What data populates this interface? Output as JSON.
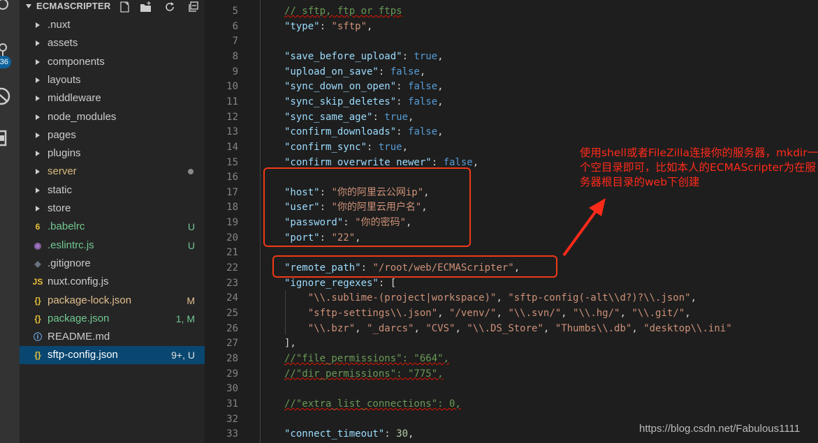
{
  "sidebar": {
    "folder": "ECMASCRIPTER",
    "items": [
      {
        "kind": "folder",
        "label": ".nuxt",
        "status": "",
        "color": "#cccccc"
      },
      {
        "kind": "folder",
        "label": "assets",
        "status": "",
        "color": "#cccccc"
      },
      {
        "kind": "folder",
        "label": "components",
        "status": "",
        "color": "#cccccc"
      },
      {
        "kind": "folder",
        "label": "layouts",
        "status": "",
        "color": "#cccccc"
      },
      {
        "kind": "folder",
        "label": "middleware",
        "status": "",
        "color": "#cccccc"
      },
      {
        "kind": "folder",
        "label": "node_modules",
        "status": "",
        "color": "#cccccc"
      },
      {
        "kind": "folder",
        "label": "pages",
        "status": "",
        "color": "#cccccc"
      },
      {
        "kind": "folder",
        "label": "plugins",
        "status": "",
        "color": "#cccccc"
      },
      {
        "kind": "folder",
        "label": "server",
        "status": "dot",
        "color": "#d7ba7d"
      },
      {
        "kind": "folder",
        "label": "static",
        "status": "",
        "color": "#cccccc"
      },
      {
        "kind": "folder",
        "label": "store",
        "status": "",
        "color": "#cccccc"
      },
      {
        "kind": "babel",
        "label": ".babelrc",
        "status": "U",
        "color": "#73c991",
        "icon": "6",
        "icon_color": "#e8c237"
      },
      {
        "kind": "eslint",
        "label": ".eslintrc.js",
        "status": "U",
        "color": "#73c991",
        "icon": "◉",
        "icon_color": "#a074c4"
      },
      {
        "kind": "git",
        "label": ".gitignore",
        "status": "",
        "color": "#cccccc",
        "icon": "◆",
        "icon_color": "#6a737d"
      },
      {
        "kind": "js",
        "label": "nuxt.config.js",
        "status": "",
        "color": "#cccccc",
        "icon": "JS",
        "icon_color": "#e8c237"
      },
      {
        "kind": "json",
        "label": "package-lock.json",
        "status": "M",
        "color": "#e2c08d",
        "icon": "{}",
        "icon_color": "#e8c237"
      },
      {
        "kind": "json",
        "label": "package.json",
        "status": "1, M",
        "color": "#73c991",
        "icon": "{}",
        "icon_color": "#e8c237"
      },
      {
        "kind": "info",
        "label": "README.md",
        "status": "",
        "color": "#cccccc",
        "icon": "ⓘ",
        "icon_color": "#75beff"
      },
      {
        "kind": "json",
        "label": "sftp-config.json",
        "status": "9+, U",
        "color": "#ffffff",
        "icon": "{}",
        "icon_color": "#e8c237",
        "selected": true
      }
    ]
  },
  "activity": {
    "badge": "36"
  },
  "editor": {
    "lines": [
      {
        "n": "5",
        "t": [
          [
            "c",
            "// sftp, ftp or ftps"
          ]
        ]
      },
      {
        "n": "6",
        "t": [
          [
            "k",
            "\"type\""
          ],
          [
            "p",
            ": "
          ],
          [
            "s",
            "\"sftp\""
          ],
          [
            "p",
            ","
          ]
        ]
      },
      {
        "n": "7",
        "t": []
      },
      {
        "n": "8",
        "t": [
          [
            "k",
            "\"save_before_upload\""
          ],
          [
            "p",
            ": "
          ],
          [
            "b",
            "true"
          ],
          [
            "p",
            ","
          ]
        ]
      },
      {
        "n": "9",
        "t": [
          [
            "k",
            "\"upload_on_save\""
          ],
          [
            "p",
            ": "
          ],
          [
            "b",
            "false"
          ],
          [
            "p",
            ","
          ]
        ]
      },
      {
        "n": "10",
        "t": [
          [
            "k",
            "\"sync_down_on_open\""
          ],
          [
            "p",
            ": "
          ],
          [
            "b",
            "false"
          ],
          [
            "p",
            ","
          ]
        ]
      },
      {
        "n": "11",
        "t": [
          [
            "k",
            "\"sync_skip_deletes\""
          ],
          [
            "p",
            ": "
          ],
          [
            "b",
            "false"
          ],
          [
            "p",
            ","
          ]
        ]
      },
      {
        "n": "12",
        "t": [
          [
            "k",
            "\"sync_same_age\""
          ],
          [
            "p",
            ": "
          ],
          [
            "b",
            "true"
          ],
          [
            "p",
            ","
          ]
        ]
      },
      {
        "n": "13",
        "t": [
          [
            "k",
            "\"confirm_downloads\""
          ],
          [
            "p",
            ": "
          ],
          [
            "b",
            "false"
          ],
          [
            "p",
            ","
          ]
        ]
      },
      {
        "n": "14",
        "t": [
          [
            "k",
            "\"confirm_sync\""
          ],
          [
            "p",
            ": "
          ],
          [
            "b",
            "true"
          ],
          [
            "p",
            ","
          ]
        ]
      },
      {
        "n": "15",
        "t": [
          [
            "k",
            "\"confirm_overwrite_newer\""
          ],
          [
            "p",
            ": "
          ],
          [
            "b",
            "false"
          ],
          [
            "p",
            ","
          ]
        ]
      },
      {
        "n": "16",
        "t": []
      },
      {
        "n": "17",
        "t": [
          [
            "k",
            "\"host\""
          ],
          [
            "p",
            ": "
          ],
          [
            "s",
            "\"你的阿里云公网ip\""
          ],
          [
            "p",
            ","
          ]
        ]
      },
      {
        "n": "18",
        "t": [
          [
            "k",
            "\"user\""
          ],
          [
            "p",
            ": "
          ],
          [
            "s",
            "\"你的阿里云用户名\""
          ],
          [
            "p",
            ","
          ]
        ]
      },
      {
        "n": "19",
        "t": [
          [
            "k",
            "\"password\""
          ],
          [
            "p",
            ": "
          ],
          [
            "s",
            "\"你的密码\""
          ],
          [
            "p",
            ","
          ]
        ]
      },
      {
        "n": "20",
        "t": [
          [
            "k",
            "\"port\""
          ],
          [
            "p",
            ": "
          ],
          [
            "s",
            "\"22\""
          ],
          [
            "p",
            ","
          ]
        ]
      },
      {
        "n": "21",
        "t": []
      },
      {
        "n": "22",
        "t": [
          [
            "k",
            "\"remote_path\""
          ],
          [
            "p",
            ": "
          ],
          [
            "s",
            "\"/root/web/ECMAScripter\""
          ],
          [
            "p",
            ","
          ]
        ]
      },
      {
        "n": "23",
        "t": [
          [
            "k",
            "\"ignore_regexes\""
          ],
          [
            "p",
            ": ["
          ]
        ]
      },
      {
        "n": "24",
        "t": [
          [
            "p",
            "    "
          ],
          [
            "s",
            "\"\\\\.sublime-(project|workspace)\""
          ],
          [
            "p",
            ", "
          ],
          [
            "s",
            "\"sftp-config(-alt\\\\d?)?\\\\.json\""
          ],
          [
            "p",
            ","
          ]
        ]
      },
      {
        "n": "25",
        "t": [
          [
            "p",
            "    "
          ],
          [
            "s",
            "\"sftp-settings\\\\.json\""
          ],
          [
            "p",
            ", "
          ],
          [
            "s",
            "\"/venv/\""
          ],
          [
            "p",
            ", "
          ],
          [
            "s",
            "\"\\\\.svn/\""
          ],
          [
            "p",
            ", "
          ],
          [
            "s",
            "\"\\\\.hg/\""
          ],
          [
            "p",
            ", "
          ],
          [
            "s",
            "\"\\\\.git/\""
          ],
          [
            "p",
            ","
          ]
        ]
      },
      {
        "n": "26",
        "t": [
          [
            "p",
            "    "
          ],
          [
            "s",
            "\"\\\\.bzr\""
          ],
          [
            "p",
            ", "
          ],
          [
            "s",
            "\"_darcs\""
          ],
          [
            "p",
            ", "
          ],
          [
            "s",
            "\"CVS\""
          ],
          [
            "p",
            ", "
          ],
          [
            "s",
            "\"\\\\.DS_Store\""
          ],
          [
            "p",
            ", "
          ],
          [
            "s",
            "\"Thumbs\\\\.db\""
          ],
          [
            "p",
            ", "
          ],
          [
            "s",
            "\"desktop\\\\.ini\""
          ]
        ]
      },
      {
        "n": "27",
        "t": [
          [
            "p",
            "],"
          ]
        ]
      },
      {
        "n": "28",
        "t": [
          [
            "c",
            "//\"file_permissions\": \"664\","
          ]
        ]
      },
      {
        "n": "29",
        "t": [
          [
            "c",
            "//\"dir_permissions\": \"775\","
          ]
        ]
      },
      {
        "n": "30",
        "t": []
      },
      {
        "n": "31",
        "t": [
          [
            "c",
            "//\"extra_list_connections\": 0,"
          ]
        ]
      },
      {
        "n": "32",
        "t": []
      },
      {
        "n": "33",
        "t": [
          [
            "k",
            "\"connect_timeout\""
          ],
          [
            "p",
            ": "
          ],
          [
            "n",
            "30"
          ],
          [
            "p",
            ","
          ]
        ]
      }
    ]
  },
  "annotation": {
    "text": "使用shell或者FileZilla连接你的服务器，mkdir一个空目录即可，比如本人的ECMAScripter为在服务器根目录的web下创建"
  },
  "watermark": "https://blog.csdn.net/Fabulous1111",
  "colors": {
    "annotation": "#ff2a1a",
    "box": "#f03a17"
  }
}
